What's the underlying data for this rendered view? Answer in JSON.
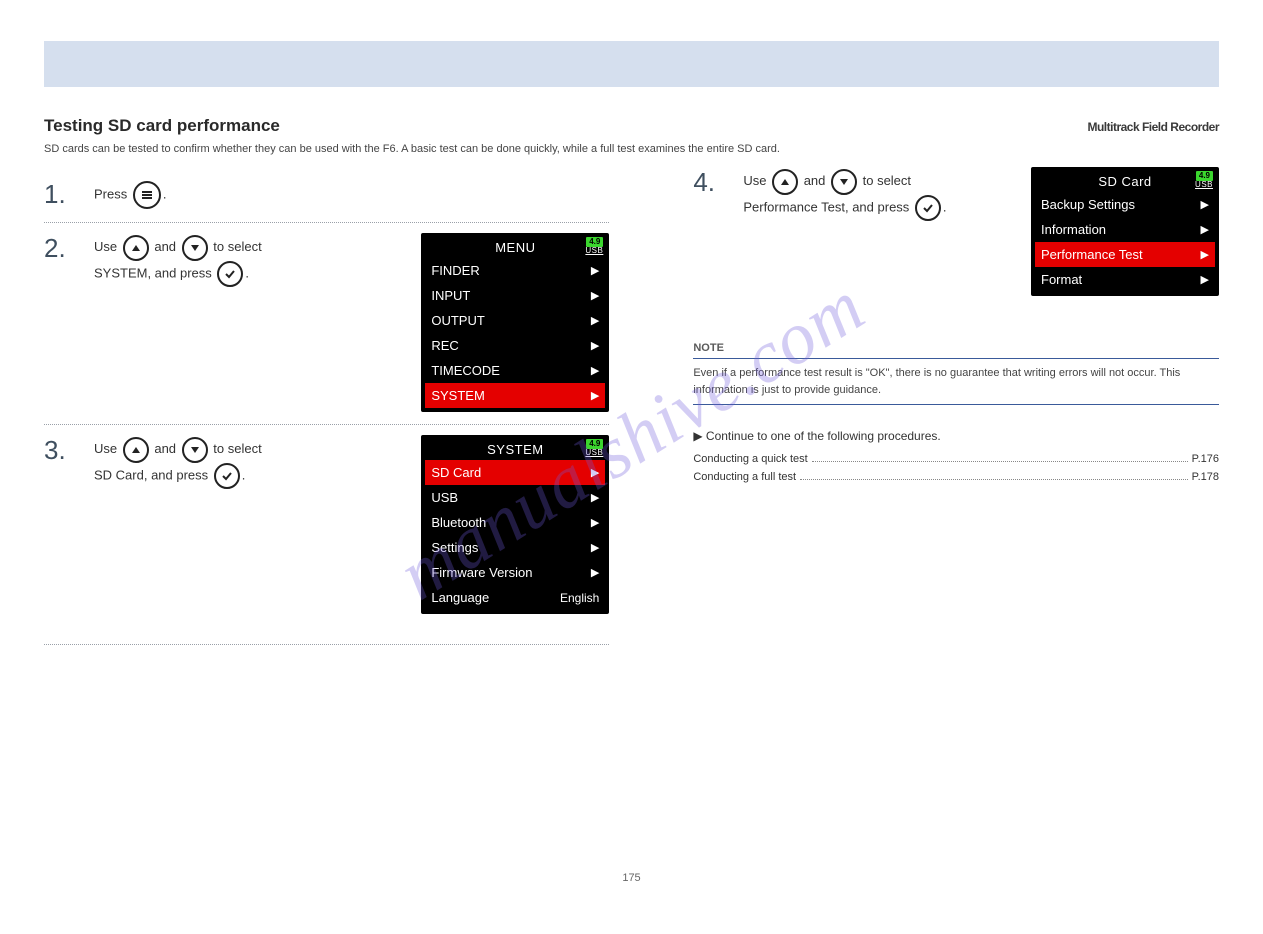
{
  "header": {
    "title": "Testing SD card performance",
    "model": "Multitrack Field Recorder",
    "subtitle": "SD cards can be tested to confirm whether they can be used with the F6. A basic test can be done quickly, while a full test examines the entire SD card."
  },
  "watermark": "manualshive.com",
  "left_steps": [
    {
      "num": "1.",
      "line": "Press {menu}.",
      "lcd": null
    },
    {
      "num": "2.",
      "line1": "Use {up} and {down} to select",
      "line2_a": "SYSTEM, and press ",
      "line2_b": ".",
      "lcd_title": "MENU",
      "lcd_rows": [
        {
          "label": "FINDER",
          "arrow": true,
          "selected": false
        },
        {
          "label": "INPUT",
          "arrow": true,
          "selected": false
        },
        {
          "label": "OUTPUT",
          "arrow": true,
          "selected": false
        },
        {
          "label": "REC",
          "arrow": true,
          "selected": false
        },
        {
          "label": "TIMECODE",
          "arrow": true,
          "selected": false
        },
        {
          "label": "SYSTEM",
          "arrow": true,
          "selected": true
        }
      ]
    },
    {
      "num": "3.",
      "line1": "Use {up} and {down} to select",
      "line2_a": "SD Card, and press ",
      "line2_b": ".",
      "lcd_title": "SYSTEM",
      "lcd_rows": [
        {
          "label": "SD Card",
          "arrow": true,
          "selected": true
        },
        {
          "label": "USB",
          "arrow": true,
          "selected": false
        },
        {
          "label": "Bluetooth",
          "arrow": true,
          "selected": false
        },
        {
          "label": "Settings",
          "arrow": true,
          "selected": false
        },
        {
          "label": "Firmware Version",
          "arrow": true,
          "selected": false
        },
        {
          "label": "Language",
          "arrow": false,
          "selected": false,
          "value": "English"
        }
      ]
    }
  ],
  "right_step": {
    "num": "4.",
    "line1": "Use {up} and {down} to select",
    "line2_a": "Performance Test, and press ",
    "line2_b": ".",
    "lcd_title": "SD Card",
    "lcd_rows": [
      {
        "label": "Backup Settings",
        "arrow": true,
        "selected": false
      },
      {
        "label": "Information",
        "arrow": true,
        "selected": false
      },
      {
        "label": "Performance Test",
        "arrow": true,
        "selected": true
      },
      {
        "label": "Format",
        "arrow": true,
        "selected": false
      }
    ]
  },
  "note": {
    "title": "NOTE",
    "body": "Even if a performance test result is \"OK\", there is no guarantee that writing errors will not occur. This information is just to provide guidance."
  },
  "lcd_indicator": {
    "battery": "4.9",
    "usb": "USB"
  },
  "continued": "▶ Continue to one of the following procedures.",
  "proc": [
    {
      "label": "Conducting a quick test",
      "page": "P.176"
    },
    {
      "label": "Conducting a full test",
      "page": "P.178"
    }
  ],
  "page_number": "175"
}
